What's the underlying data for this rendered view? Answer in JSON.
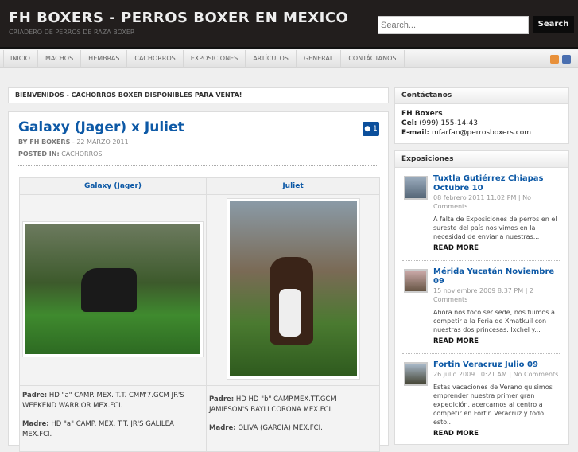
{
  "header": {
    "title": "FH BOXERS - PERROS BOXER EN MEXICO",
    "tagline": "CRIADERO DE PERROS DE RAZA BOXER",
    "search_placeholder": "Search...",
    "search_button": "Search"
  },
  "nav": [
    "INICIO",
    "MACHOS",
    "HEMBRAS",
    "CACHORROS",
    "EXPOSICIONES",
    "ARTÍCULOS",
    "GENERAL",
    "CONTÁCTANOS"
  ],
  "welcome": "BIENVENIDOS - CACHORROS BOXER DISPONIBLES PARA VENTA!",
  "post": {
    "title": "Galaxy (Jager) x Juliet",
    "comments": "1",
    "by_label": "BY FH BOXERS",
    "date": "- 22 MARZO 2011",
    "posted_label": "POSTED IN:",
    "category": "CACHORROS",
    "left": {
      "name": "Galaxy (Jager)",
      "padre_label": "Padre:",
      "padre": "HD \"a\" CAMP. MEX. T.T. CMM'7.GCM JR'S WEEKEND WARRIOR MEX.FCI.",
      "madre_label": "Madre:",
      "madre": "HD \"a\" CAMP. MEX. T.T. JR'S GALILEA MEX.FCI."
    },
    "right": {
      "name": "Juliet",
      "padre_label": "Padre:",
      "padre": "HD HD \"b\" CAMP.MEX.TT.GCM JAMIESON'S BAYLI CORONA MEX.FCI.",
      "madre_label": "Madre:",
      "madre": "OLIVA (GARCIA) MEX.FCI."
    }
  },
  "contact": {
    "title": "Contáctanos",
    "name": "FH Boxers",
    "cel_label": "Cel:",
    "cel": "(999) 155-14-43",
    "email_label": "E-mail:",
    "email": "mfarfan@perrosboxers.com"
  },
  "expo": {
    "title": "Exposiciones",
    "items": [
      {
        "title": "Tuxtla Gutiérrez Chiapas Octubre 10",
        "meta": "08 febrero 2011 11:02 PM | No Comments",
        "excerpt": "A falta de Exposiciones de perros en el sureste del país nos vimos en la necesidad de enviar a nuestras...",
        "more": "READ MORE"
      },
      {
        "title": "Mérida Yucatán Noviembre 09",
        "meta": "15 noviembre 2009 8:37 PM | 2 Comments",
        "excerpt": "Ahora nos toco ser sede, nos fuimos a competir a la Feria de Xmatkuil con nuestras dos princesas: Ixchel y...",
        "more": "READ MORE"
      },
      {
        "title": "Fortin Veracruz Julio 09",
        "meta": "26 julio 2009 10:21 AM | No Comments",
        "excerpt": "Estas vacaciones de Verano quisimos emprender nuestra primer gran expedición, acercarnos al centro a competir en Fortin Veracruz y todo esto...",
        "more": "READ MORE"
      }
    ]
  }
}
